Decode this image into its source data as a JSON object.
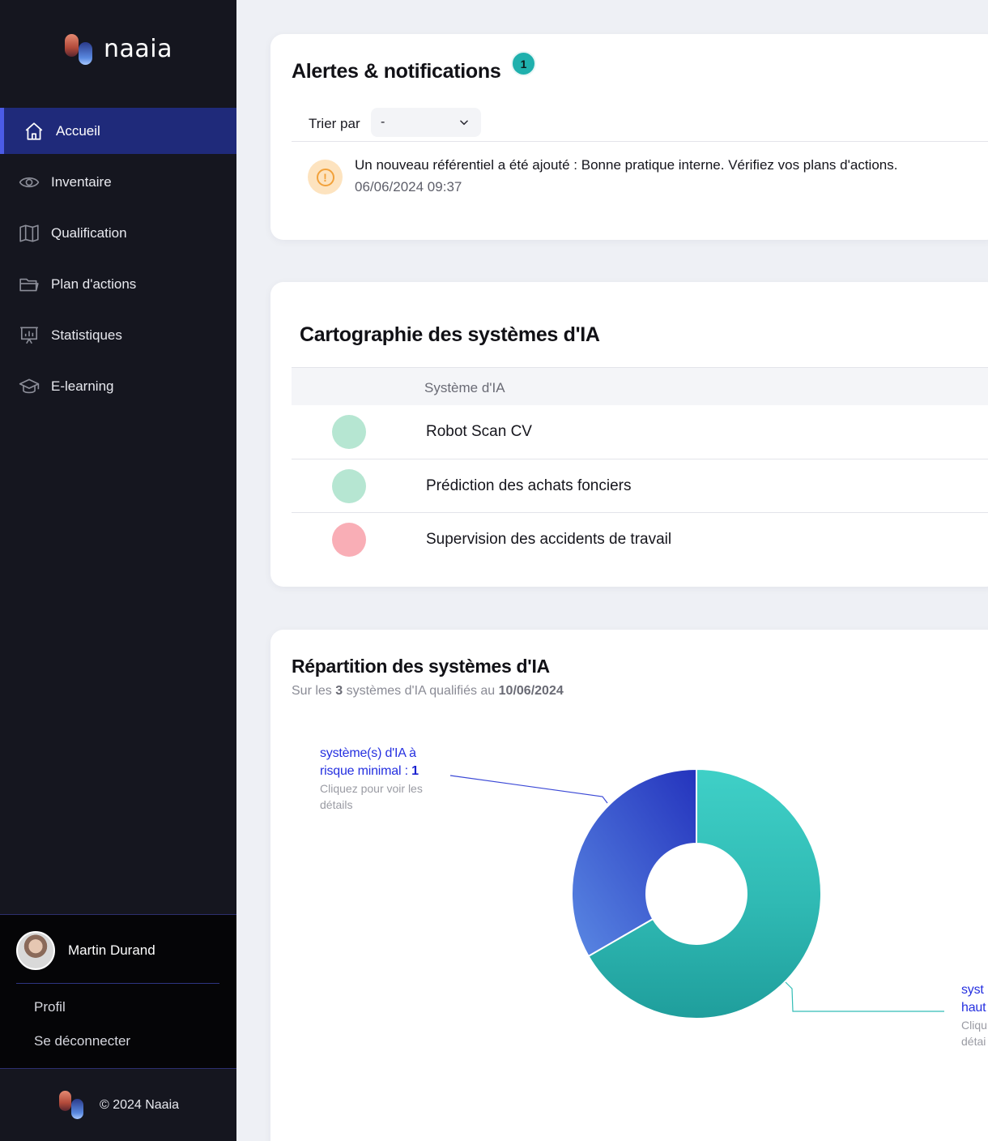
{
  "brand": {
    "name": "naaia",
    "footer": "© 2024 Naaia"
  },
  "sidebar": {
    "items": [
      {
        "label": "Accueil",
        "icon": "home-icon",
        "active": true
      },
      {
        "label": "Inventaire",
        "icon": "eye-icon",
        "active": false
      },
      {
        "label": "Qualification",
        "icon": "map-icon",
        "active": false
      },
      {
        "label": "Plan d'actions",
        "icon": "folder-icon",
        "active": false
      },
      {
        "label": "Statistiques",
        "icon": "presentation-chart-icon",
        "active": false
      },
      {
        "label": "E-learning",
        "icon": "graduation-cap-icon",
        "active": false
      }
    ],
    "user": {
      "name": "Martin Durand",
      "profile_link": "Profil",
      "logout_link": "Se déconnecter"
    }
  },
  "alerts": {
    "title": "Alertes & notifications",
    "count": "1",
    "sort_label": "Trier par",
    "sort_value": "-",
    "items": [
      {
        "message": "Un nouveau référentiel a été ajouté : Bonne pratique interne. Vérifiez vos plans d'actions.",
        "date": "06/06/2024 09:37",
        "icon": "warning-icon"
      }
    ]
  },
  "cartography": {
    "title": "Cartographie des systèmes d'IA",
    "column_header": "Système d'IA",
    "rows": [
      {
        "name": "Robot Scan CV",
        "risk_color": "#b6e6d2"
      },
      {
        "name": "Prédiction des achats fonciers",
        "risk_color": "#b6e6d2"
      },
      {
        "name": "Supervision des accidents de travail",
        "risk_color": "#f9aeb6"
      }
    ]
  },
  "repartition": {
    "title": "Répartition des systèmes d'IA",
    "subtitle_prefix": "Sur les",
    "subtitle_count": "3",
    "subtitle_middle": "systèmes d'IA qualifiés au",
    "subtitle_date": "10/06/2024",
    "minimal_label": "système(s) d'IA à risque minimal :",
    "minimal_count": "1",
    "minimal_hint": "Cliquez pour voir les détails",
    "high_label": "syst",
    "high_label_2": "haut",
    "high_hint": "Cliqu",
    "high_hint_2": "détai"
  },
  "colors": {
    "sidebar_bg": "#15161f",
    "active_item_bg": "#1f2a7a",
    "accent_teal": "#1fb0ad",
    "minimal_risk": "#3c56d1",
    "high_risk": "#2fb9b3"
  },
  "chart_data": {
    "type": "pie",
    "categories": [
      "système(s) d'IA à risque minimal",
      "haut risque"
    ],
    "values": [
      1,
      2
    ]
  }
}
